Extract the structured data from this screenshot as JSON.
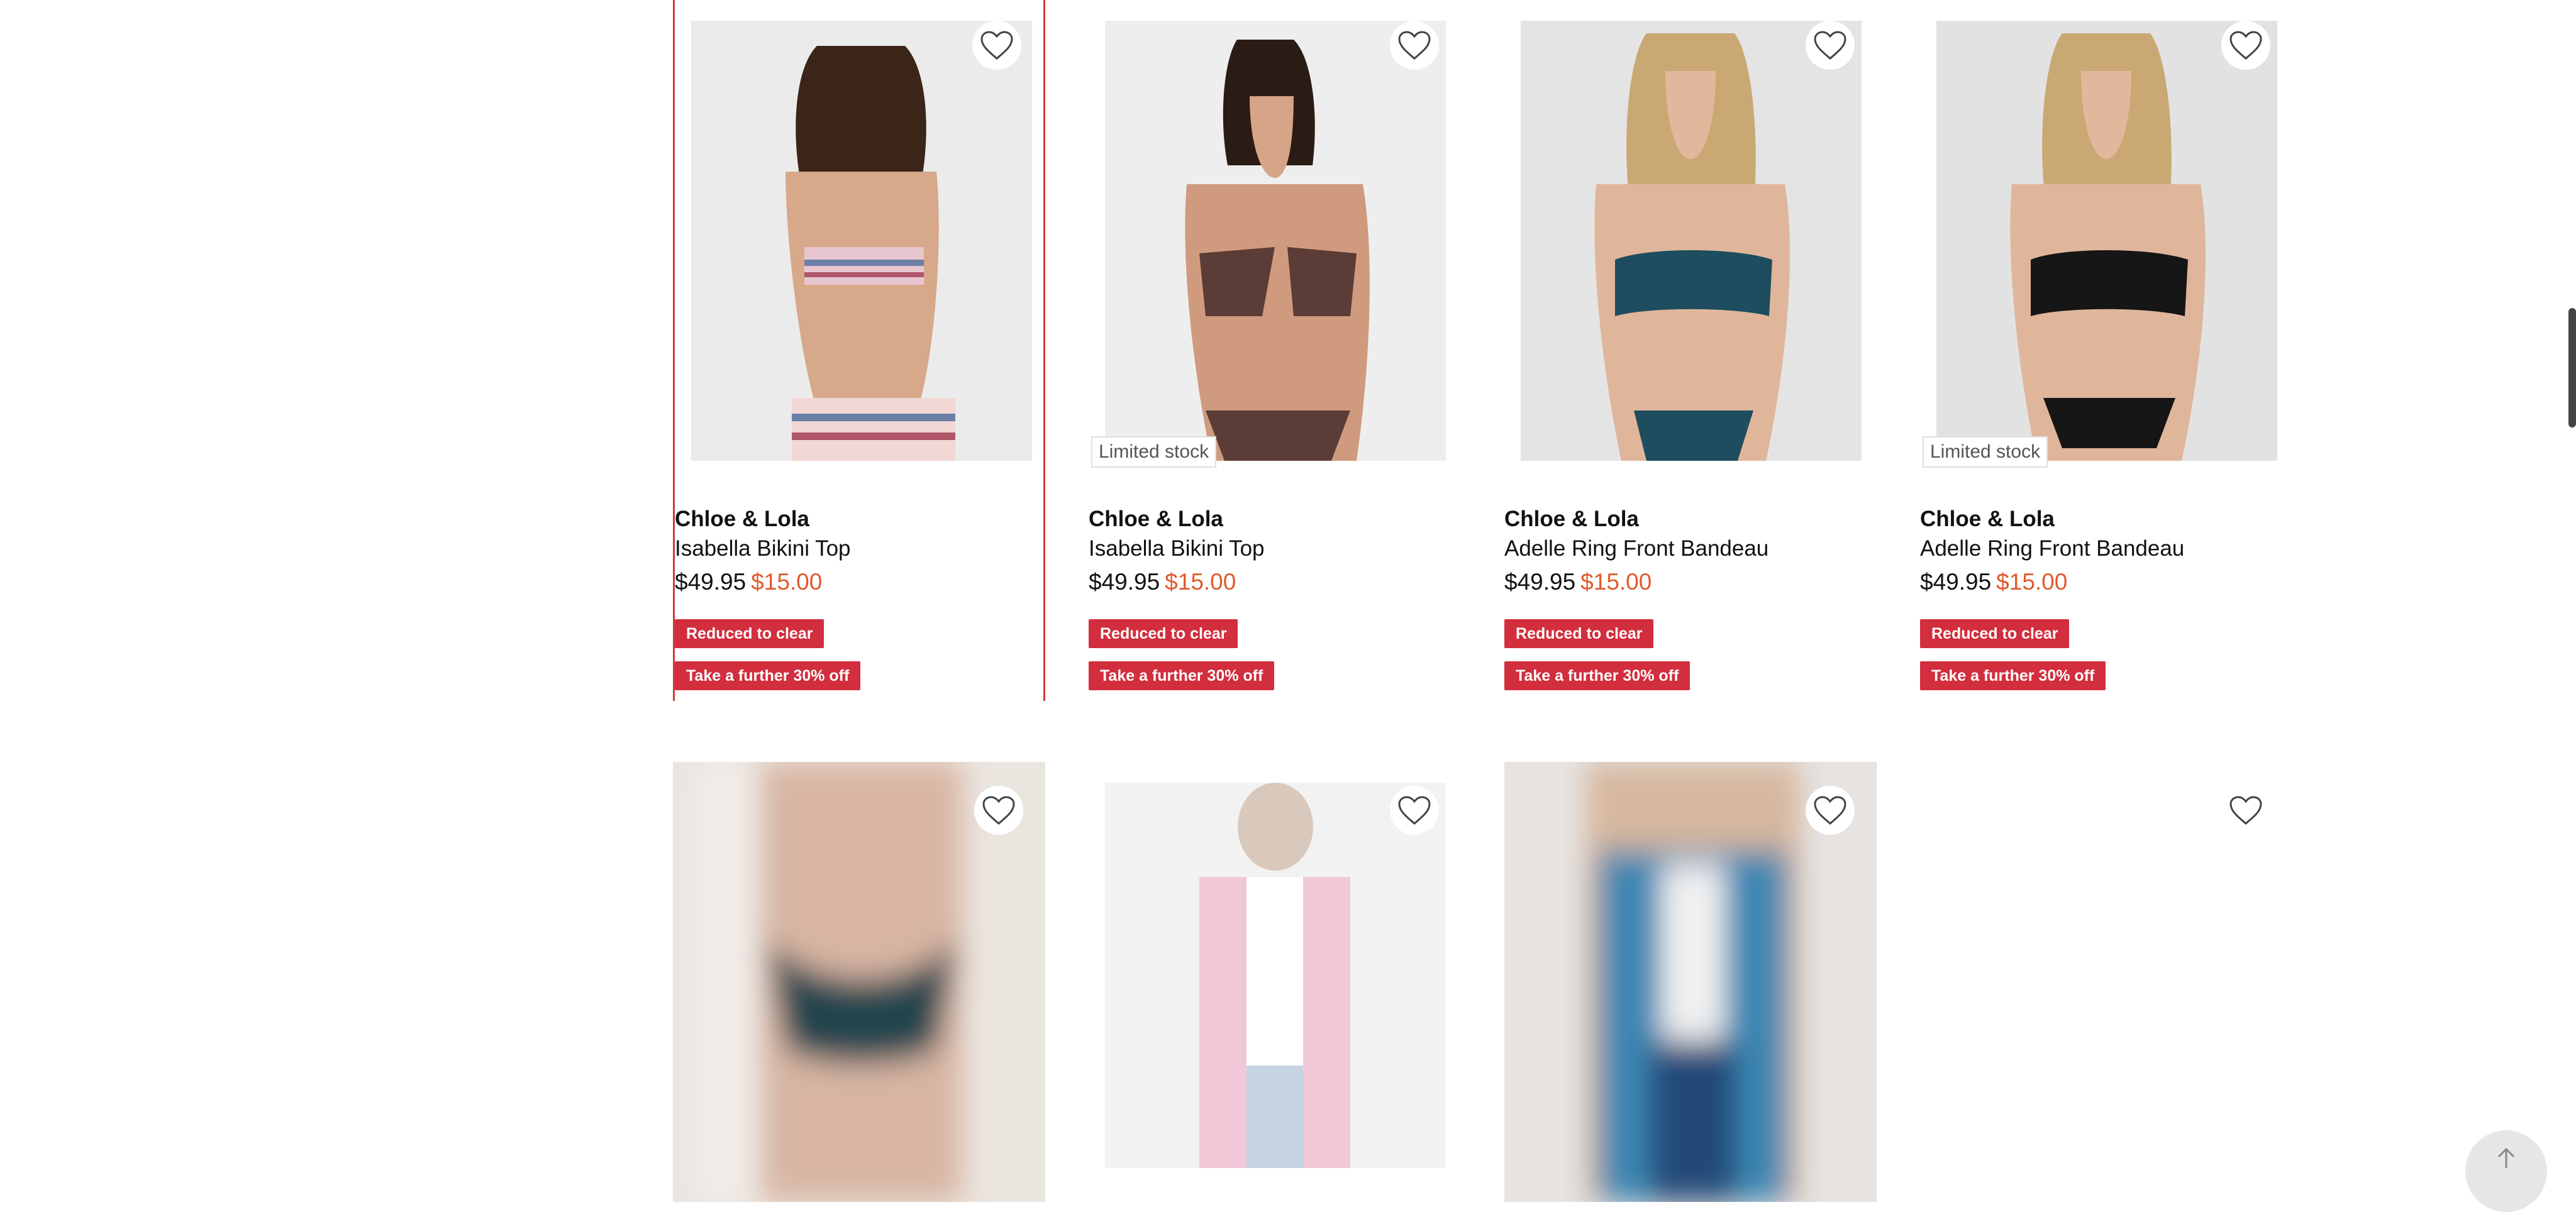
{
  "products": [
    {
      "brand": "Chloe & Lola",
      "name": "Isabella Bikini Top",
      "was_price": "$49.95",
      "now_price": "$15.00",
      "stock": "",
      "badge1": "Reduced to clear",
      "badge2": "Take a further 30% off"
    },
    {
      "brand": "Chloe & Lola",
      "name": "Isabella Bikini Top",
      "was_price": "$49.95",
      "now_price": "$15.00",
      "stock": "Limited stock",
      "badge1": "Reduced to clear",
      "badge2": "Take a further 30% off"
    },
    {
      "brand": "Chloe & Lola",
      "name": "Adelle Ring Front Bandeau",
      "was_price": "$49.95",
      "now_price": "$15.00",
      "stock": "",
      "badge1": "Reduced to clear",
      "badge2": "Take a further 30% off"
    },
    {
      "brand": "Chloe & Lola",
      "name": "Adelle Ring Front Bandeau",
      "was_price": "$49.95",
      "now_price": "$15.00",
      "stock": "Limited stock",
      "badge1": "Reduced to clear",
      "badge2": "Take a further 30% off"
    }
  ],
  "icons": {
    "wishlist": "heart-outline-icon",
    "back_to_top": "arrow-up-icon"
  },
  "colors": {
    "badge": "#d22e3e",
    "sale_price": "#e05a2b",
    "selected_border": "#d23a3a"
  }
}
